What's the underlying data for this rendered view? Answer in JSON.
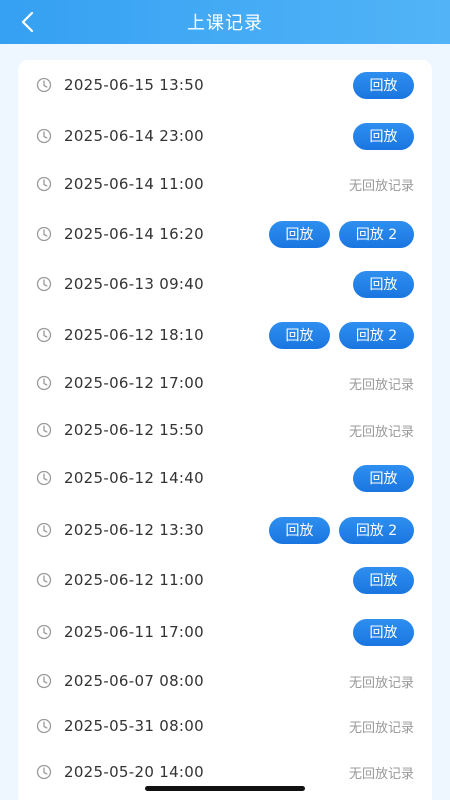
{
  "header": {
    "title": "上课记录",
    "back_icon": "chevron-left-icon"
  },
  "colors": {
    "header_start": "#35a0f2",
    "button": "#1976e0",
    "no_record": "#999999"
  },
  "records": [
    {
      "time": "2025-06-15 13:50",
      "buttons": [
        "回放"
      ]
    },
    {
      "time": "2025-06-14 23:00",
      "buttons": [
        "回放"
      ]
    },
    {
      "time": "2025-06-14 11:00",
      "buttons": [],
      "status": "无回放记录"
    },
    {
      "time": "2025-06-14 16:20",
      "buttons": [
        "回放",
        "回放 2"
      ]
    },
    {
      "time": "2025-06-13 09:40",
      "buttons": [
        "回放"
      ]
    },
    {
      "time": "2025-06-12 18:10",
      "buttons": [
        "回放",
        "回放 2"
      ]
    },
    {
      "time": "2025-06-12 17:00",
      "buttons": [],
      "status": "无回放记录"
    },
    {
      "time": "2025-06-12 15:50",
      "buttons": [],
      "status": "无回放记录"
    },
    {
      "time": "2025-06-12 14:40",
      "buttons": [
        "回放"
      ]
    },
    {
      "time": "2025-06-12 13:30",
      "buttons": [
        "回放",
        "回放 2"
      ]
    },
    {
      "time": "2025-06-12 11:00",
      "buttons": [
        "回放"
      ]
    },
    {
      "time": "2025-06-11 17:00",
      "buttons": [
        "回放"
      ]
    },
    {
      "time": "2025-06-07 08:00",
      "buttons": [],
      "status": "无回放记录"
    },
    {
      "time": "2025-05-31 08:00",
      "buttons": [],
      "status": "无回放记录"
    },
    {
      "time": "2025-05-20 14:00",
      "buttons": [],
      "status": "无回放记录"
    }
  ]
}
